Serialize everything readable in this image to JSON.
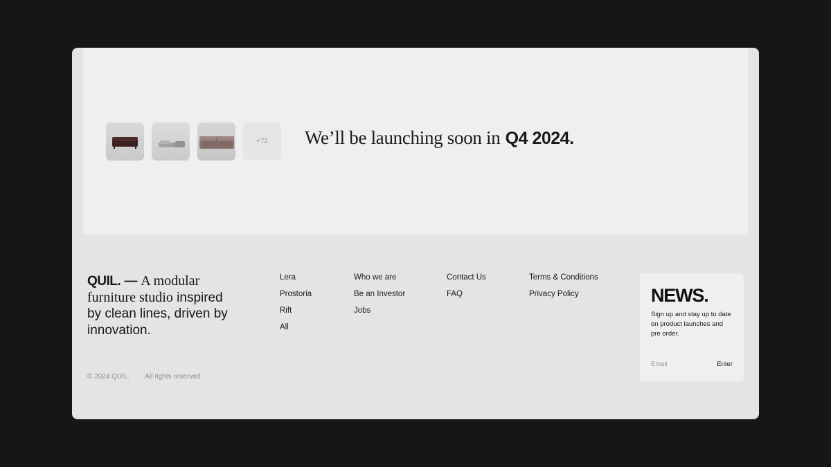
{
  "hero": {
    "thumbnails": [
      {
        "icon": "dark-sofa-thumbnail",
        "color": "#3a2220"
      },
      {
        "icon": "grey-sectional-thumbnail",
        "color": "#9c9c9c"
      },
      {
        "icon": "mauve-sofa-thumbnail",
        "color": "#8a7470"
      }
    ],
    "more_count": "+72",
    "headline_prefix": "We’ll be launching soon in",
    "headline_highlight": "Q4 2024."
  },
  "footer": {
    "brand_name": "QUIL.",
    "brand_dash": "—",
    "tagline_serif": "A modular furniture studio",
    "tagline_sans": "inspired by clean lines, driven by innovation.",
    "copyright": "© 2024 QUIL.",
    "rights": "All rights reserved",
    "columns": [
      [
        "Lera",
        "Prostoria",
        "Rift",
        "All"
      ],
      [
        "Who we are",
        "Be an Investor",
        "Jobs"
      ],
      [
        "Contact Us",
        "FAQ"
      ],
      [
        "Terms & Conditions",
        "Privacy Policy"
      ]
    ]
  },
  "news": {
    "title": "NEWS.",
    "description": "Sign up and stay up to date on product launches and pre order.",
    "email_placeholder": "Email",
    "submit_label": "Enter"
  },
  "colors": {
    "page_bg": "#161616",
    "frame_bg": "#e4e4e4",
    "panel_bg": "#efefef",
    "text": "#161616",
    "muted": "#8e8e8e"
  }
}
